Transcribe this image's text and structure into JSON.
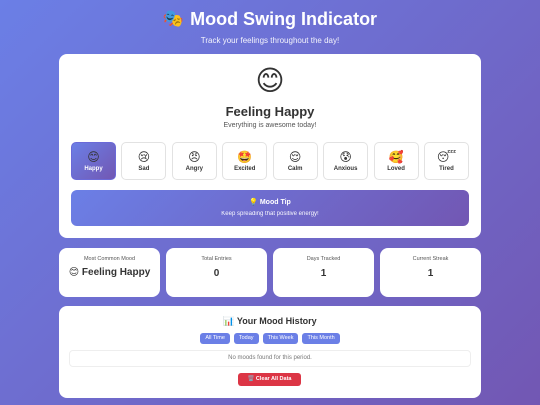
{
  "header": {
    "title_icon": "🎭",
    "title": "Mood Swing Indicator",
    "subtitle": "Track your feelings throughout the day!"
  },
  "current": {
    "emoji": "😊",
    "title": "Feeling Happy",
    "description": "Everything is awesome today!"
  },
  "moods": [
    {
      "emoji": "😊",
      "label": "Happy",
      "active": true
    },
    {
      "emoji": "😢",
      "label": "Sad"
    },
    {
      "emoji": "😠",
      "label": "Angry"
    },
    {
      "emoji": "🤩",
      "label": "Excited"
    },
    {
      "emoji": "😌",
      "label": "Calm"
    },
    {
      "emoji": "😰",
      "label": "Anxious"
    },
    {
      "emoji": "🥰",
      "label": "Loved"
    },
    {
      "emoji": "😴",
      "label": "Tired"
    }
  ],
  "tip": {
    "icon": "💡",
    "title": "Mood Tip",
    "text": "Keep spreading that positive energy!"
  },
  "stats": {
    "most_common": {
      "label": "Most Common Mood",
      "value": "😊 Feeling Happy"
    },
    "total_entries": {
      "label": "Total Entries",
      "value": "0"
    },
    "days_tracked": {
      "label": "Days Tracked",
      "value": "1"
    },
    "current_streak": {
      "label": "Current Streak",
      "value": "1"
    }
  },
  "history": {
    "icon": "📊",
    "title": "Your Mood History",
    "filters": [
      "All Time",
      "Today",
      "This Week",
      "This Month"
    ],
    "empty_message": "No moods found for this period.",
    "clear_icon": "🗑️",
    "clear_label": "Clear All Data"
  },
  "colors": {
    "gradient_start": "#6b7fe6",
    "gradient_end": "#7257b3",
    "danger": "#dc3545"
  }
}
